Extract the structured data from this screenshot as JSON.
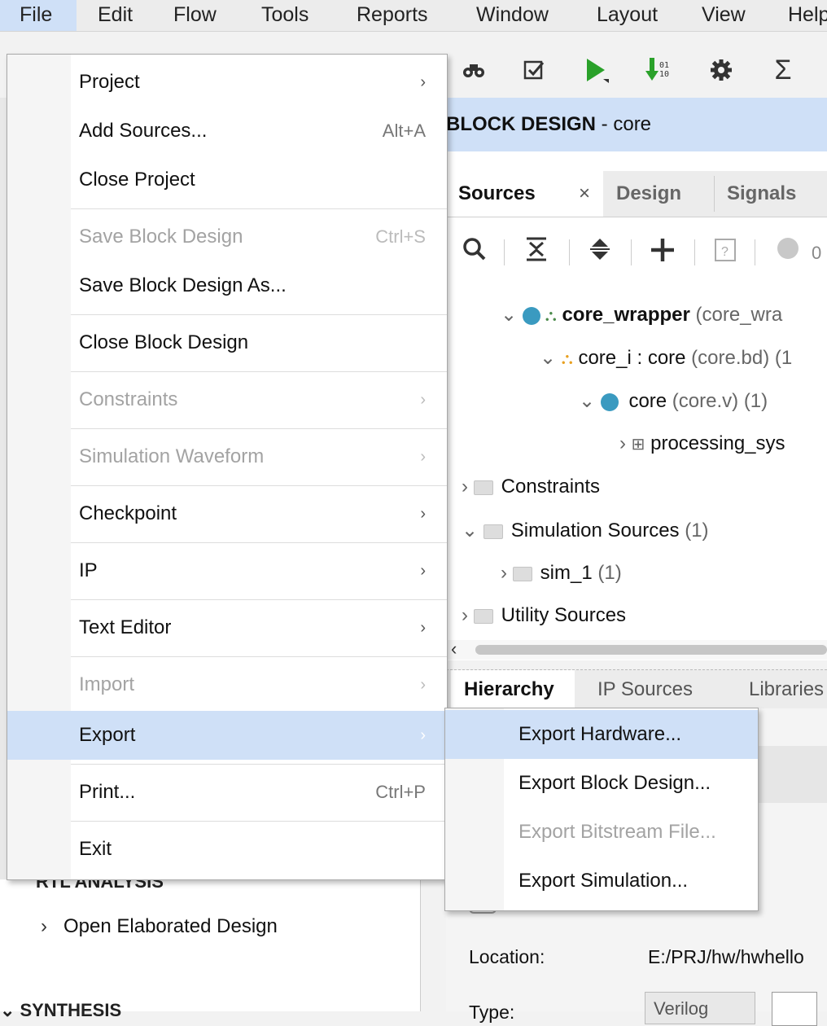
{
  "menubar": {
    "items": [
      "File",
      "Edit",
      "Flow",
      "Tools",
      "Reports",
      "Window",
      "Layout",
      "View",
      "Help"
    ]
  },
  "header": {
    "title_bold": "BLOCK DESIGN",
    "title_rest": " - core"
  },
  "sources_panel": {
    "tabs": [
      "Sources",
      "Design",
      "Signals"
    ],
    "close_glyph": "×",
    "badge_count": "0",
    "tree": [
      {
        "label": "core_wrapper",
        "suffix": " (core_wra",
        "bold": true
      },
      {
        "label": "core_i : core",
        "suffix": " (core.bd) (1"
      },
      {
        "label": "core",
        "suffix": " (core.v) (1)"
      },
      {
        "label": "processing_sys",
        "suffix": ""
      },
      {
        "label": "Constraints",
        "suffix": ""
      },
      {
        "label": "Simulation Sources",
        "suffix": " (1)"
      },
      {
        "label": "sim_1",
        "suffix": " (1)"
      },
      {
        "label": "Utility Sources",
        "suffix": ""
      }
    ]
  },
  "bottom_tabs": [
    "Hierarchy",
    "IP Sources",
    "Libraries"
  ],
  "properties": {
    "location_label": "Location:",
    "location_value": "E:/PRJ/hw/hwhello",
    "type_label": "Type:",
    "type_value": "Verilog"
  },
  "left_panel": {
    "section_cut": "RTL ANALYSIS",
    "item": "Open Elaborated Design",
    "synthesis_cut": "SYNTHESIS"
  },
  "file_menu": {
    "items": [
      {
        "label": "Project",
        "submenu": true,
        "enabled": true
      },
      {
        "label": "Add Sources...",
        "shortcut": "Alt+A",
        "enabled": true
      },
      {
        "label": "Close Project",
        "enabled": true
      },
      {
        "label": "Save Block Design",
        "shortcut": "Ctrl+S",
        "enabled": false
      },
      {
        "label": "Save Block Design As...",
        "enabled": true
      },
      {
        "label": "Close Block Design",
        "enabled": true
      },
      {
        "label": "Constraints",
        "submenu": true,
        "enabled": false
      },
      {
        "label": "Simulation Waveform",
        "submenu": true,
        "enabled": false
      },
      {
        "label": "Checkpoint",
        "submenu": true,
        "enabled": true
      },
      {
        "label": "IP",
        "submenu": true,
        "enabled": true
      },
      {
        "label": "Text Editor",
        "submenu": true,
        "enabled": true
      },
      {
        "label": "Import",
        "submenu": true,
        "enabled": false
      },
      {
        "label": "Export",
        "submenu": true,
        "enabled": true,
        "highlighted": true
      },
      {
        "label": "Print...",
        "shortcut": "Ctrl+P",
        "enabled": true
      },
      {
        "label": "Exit",
        "enabled": true
      }
    ],
    "submenu_arrow": "›"
  },
  "export_submenu": {
    "items": [
      {
        "label": "Export Hardware...",
        "enabled": true,
        "highlighted": true
      },
      {
        "label": "Export Block Design...",
        "enabled": true
      },
      {
        "label": "Export Bitstream File...",
        "enabled": false
      },
      {
        "label": "Export Simulation...",
        "enabled": true
      }
    ]
  },
  "colors": {
    "highlight": "#cfe0f7",
    "accent_green": "#2aa12a",
    "status_blue": "#3a9ac0"
  }
}
